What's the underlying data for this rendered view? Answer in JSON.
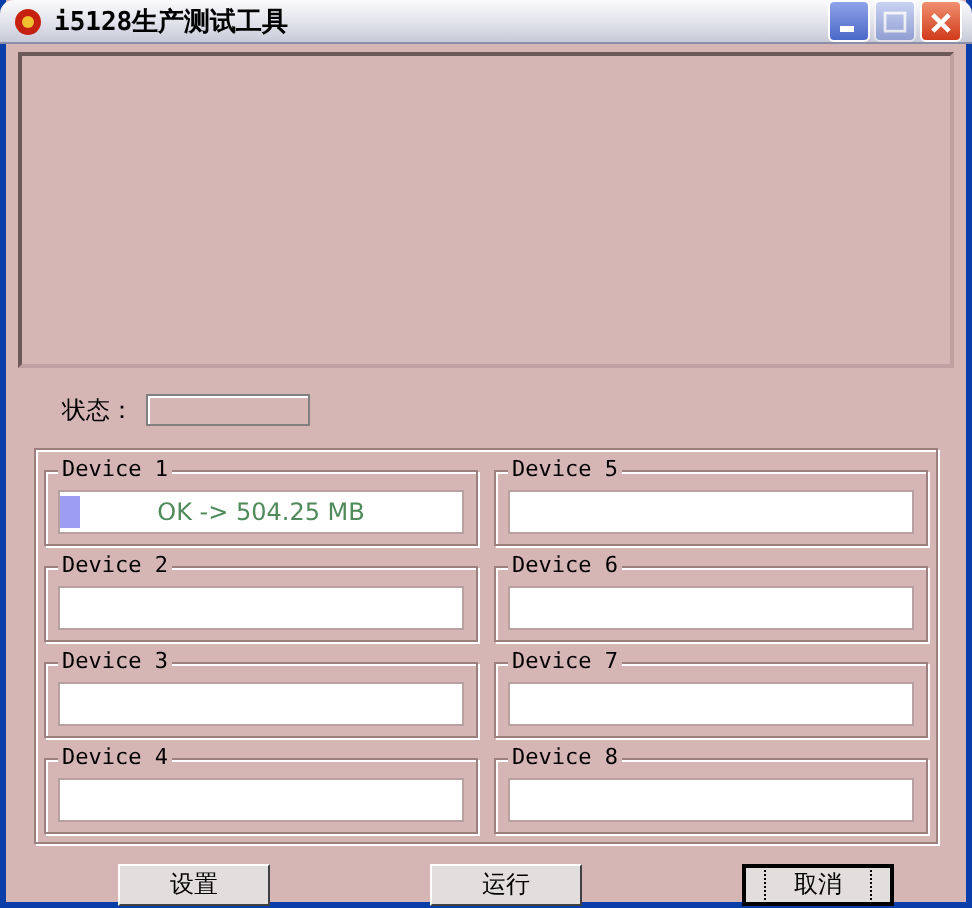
{
  "window": {
    "title": "i5128生产测试工具"
  },
  "status": {
    "label": "状态："
  },
  "devices": [
    {
      "name": "Device 1",
      "level": 0.05,
      "reading": "OK -> 504.25 MB"
    },
    {
      "name": "Device 2",
      "level": 0
    },
    {
      "name": "Device 3",
      "level": 0
    },
    {
      "name": "Device 4",
      "level": 0
    },
    {
      "name": "Device 5",
      "level": 0
    },
    {
      "name": "Device 6",
      "level": 0
    },
    {
      "name": "Device 7",
      "level": 0
    },
    {
      "name": "Device 8",
      "level": 0
    }
  ],
  "buttons": [
    {
      "label": "设置",
      "default": false
    },
    {
      "label": "运行",
      "default": false
    },
    {
      "label": "取消",
      "default": true
    }
  ]
}
